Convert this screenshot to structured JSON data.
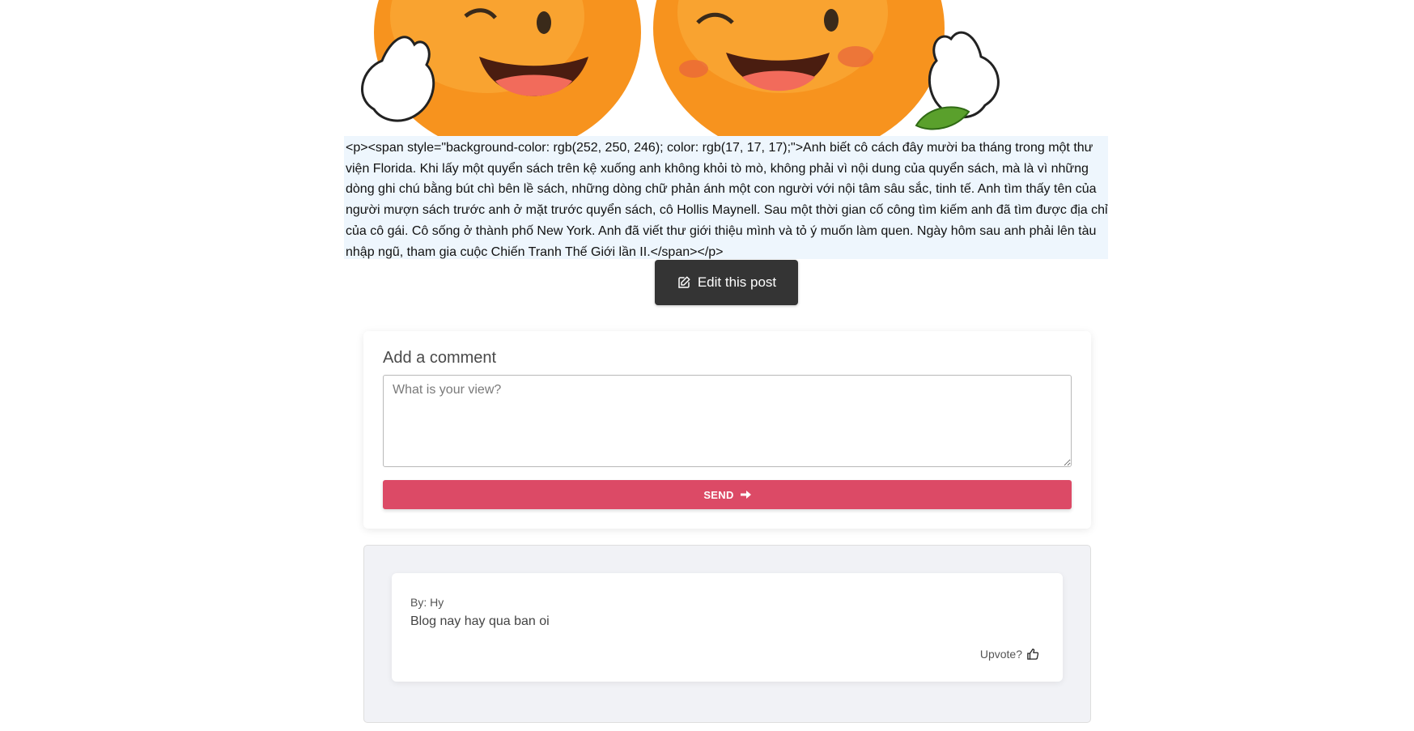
{
  "post": {
    "body_text": "<p><span style=\"background-color: rgb(252, 250, 246); color: rgb(17, 17, 17);\">Anh biết cô cách đây mười ba tháng trong một thư viện Florida. Khi lấy một quyển sách trên kệ xuống anh không khỏi tò mò, không phải vì nội dung của quyển sách, mà là vì những dòng ghi chú bằng bút chì bên lề sách, những dòng chữ phản ánh một con người với nội tâm sâu sắc, tinh tế. Anh tìm thấy tên của người mượn sách trước anh ở mặt trước quyển sách, cô Hollis Maynell. Sau một thời gian cố công tìm kiếm anh đã tìm được địa chỉ của cô gái. Cô sống ở thành phố New York. Anh đã viết thư giới thiệu mình và tỏ ý muốn làm quen. Ngày hôm sau anh phải lên tàu nhập ngũ, tham gia cuộc Chiến Tranh Thế Giới lần II.</span></p>",
    "edit_label": "Edit this post",
    "edit_icon": "pencil-square-icon"
  },
  "comment_form": {
    "title": "Add a comment",
    "placeholder": "What is your view?",
    "send_label": "SEND",
    "send_icon": "arrow-right-icon",
    "send_color": "#dc4a66"
  },
  "comments": [
    {
      "author": "By: Hy",
      "text": "Blog nay hay qua ban oi",
      "upvote_label": "Upvote?",
      "upvote_icon": "thumbs-up-icon"
    }
  ]
}
